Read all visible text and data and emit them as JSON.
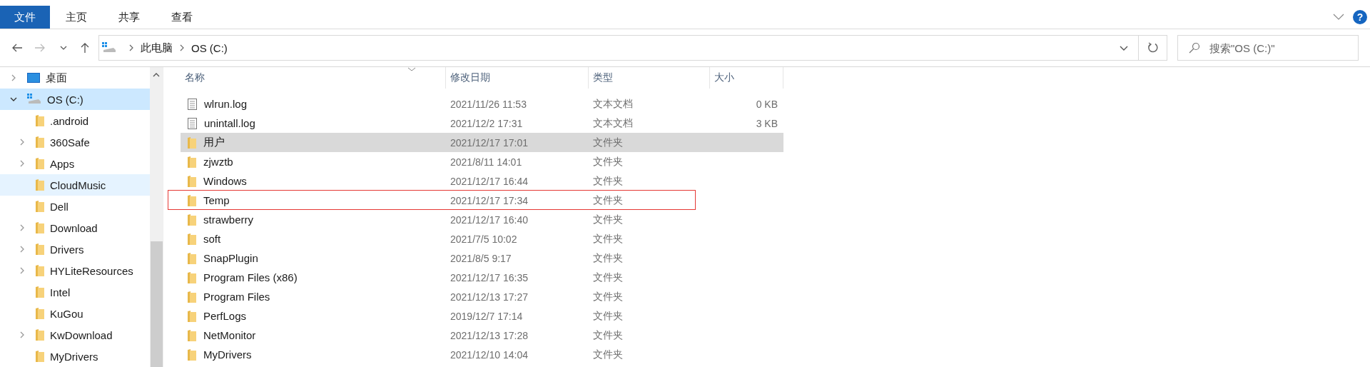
{
  "ribbon": {
    "help_button": "?",
    "tabs": [
      {
        "label": "文件",
        "selected": true
      },
      {
        "label": "主页",
        "selected": false
      },
      {
        "label": "共享",
        "selected": false
      },
      {
        "label": "查看",
        "selected": false
      }
    ]
  },
  "address_bar": {
    "path": [
      "此电脑",
      "OS (C:)"
    ],
    "search_placeholder": "搜索\"OS (C:)\""
  },
  "sidebar": {
    "items": [
      {
        "label": "桌面",
        "kind": "desktop",
        "expanded": false,
        "selected": false,
        "highlighted": false
      },
      {
        "label": "OS (C:)",
        "kind": "drive",
        "expanded": true,
        "selected": true,
        "highlighted": false,
        "children": [
          {
            "label": ".android",
            "kind": "folder",
            "selected": false,
            "highlighted": false
          },
          {
            "label": "360Safe",
            "kind": "folder",
            "expanded": false,
            "selected": false,
            "highlighted": false
          },
          {
            "label": "Apps",
            "kind": "folder",
            "expanded": false,
            "selected": false,
            "highlighted": false
          },
          {
            "label": "CloudMusic",
            "kind": "folder",
            "selected": false,
            "highlighted": true
          },
          {
            "label": "Dell",
            "kind": "folder",
            "selected": false,
            "highlighted": false
          },
          {
            "label": "Download",
            "kind": "folder",
            "expanded": false,
            "selected": false,
            "highlighted": false
          },
          {
            "label": "Drivers",
            "kind": "folder",
            "expanded": false,
            "selected": false,
            "highlighted": false
          },
          {
            "label": "HYLiteResources",
            "kind": "folder",
            "expanded": false,
            "selected": false,
            "highlighted": false
          },
          {
            "label": "Intel",
            "kind": "folder",
            "selected": false,
            "highlighted": false
          },
          {
            "label": "KuGou",
            "kind": "folder",
            "selected": false,
            "highlighted": false
          },
          {
            "label": "KwDownload",
            "kind": "folder",
            "expanded": false,
            "selected": false,
            "highlighted": false
          },
          {
            "label": "MyDrivers",
            "kind": "folder",
            "selected": false,
            "highlighted": false
          }
        ]
      }
    ]
  },
  "table": {
    "columns": [
      "名称",
      "修改日期",
      "类型",
      "大小"
    ],
    "rows": [
      {
        "name": "wlrun.log",
        "kind": "file",
        "date": "2021/11/26 11:53",
        "type": "文本文档",
        "size": "0 KB",
        "selected": false,
        "outlined": false
      },
      {
        "name": "unintall.log",
        "kind": "file",
        "date": "2021/12/2 17:31",
        "type": "文本文档",
        "size": "3 KB",
        "selected": false,
        "outlined": false
      },
      {
        "name": "用户",
        "kind": "folder",
        "date": "2021/12/17 17:01",
        "type": "文件夹",
        "selected": true,
        "outlined": false
      },
      {
        "name": "zjwztb",
        "kind": "folder",
        "date": "2021/8/11 14:01",
        "type": "文件夹",
        "selected": false,
        "outlined": false
      },
      {
        "name": "Windows",
        "kind": "folder",
        "date": "2021/12/17 16:44",
        "type": "文件夹",
        "selected": false,
        "outlined": false
      },
      {
        "name": "Temp",
        "kind": "folder",
        "date": "2021/12/17 17:34",
        "type": "文件夹",
        "selected": false,
        "outlined": true
      },
      {
        "name": "strawberry",
        "kind": "folder",
        "date": "2021/12/17 16:40",
        "type": "文件夹",
        "selected": false,
        "outlined": false
      },
      {
        "name": "soft",
        "kind": "folder",
        "date": "2021/7/5 10:02",
        "type": "文件夹",
        "selected": false,
        "outlined": false
      },
      {
        "name": "SnapPlugin",
        "kind": "folder",
        "date": "2021/8/5 9:17",
        "type": "文件夹",
        "selected": false,
        "outlined": false
      },
      {
        "name": "Program Files (x86)",
        "kind": "folder",
        "date": "2021/12/17 16:35",
        "type": "文件夹",
        "selected": false,
        "outlined": false
      },
      {
        "name": "Program Files",
        "kind": "folder",
        "date": "2021/12/13 17:27",
        "type": "文件夹",
        "selected": false,
        "outlined": false
      },
      {
        "name": "PerfLogs",
        "kind": "folder",
        "date": "2019/12/7 17:14",
        "type": "文件夹",
        "selected": false,
        "outlined": false
      },
      {
        "name": "NetMonitor",
        "kind": "folder",
        "date": "2021/12/13 17:28",
        "type": "文件夹",
        "selected": false,
        "outlined": false
      },
      {
        "name": "MyDrivers",
        "kind": "folder",
        "date": "2021/12/10 14:04",
        "type": "文件夹",
        "selected": false,
        "outlined": false
      }
    ]
  }
}
